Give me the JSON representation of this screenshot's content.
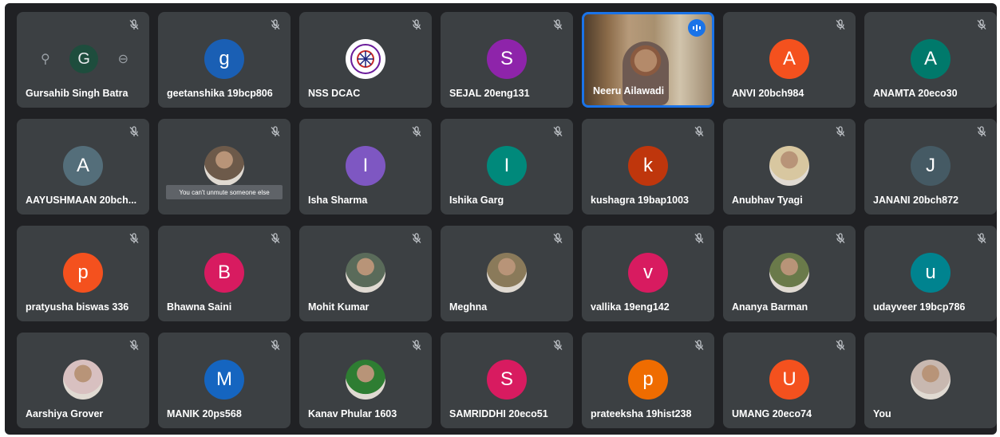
{
  "participants": [
    {
      "name": "Gursahib Singh Batra",
      "initial": "G",
      "color": "#1e4d3d",
      "muted": true,
      "avatar": "hover-controls"
    },
    {
      "name": "geetanshika 19bcp806",
      "initial": "g",
      "color": "#1a5fb4",
      "muted": true,
      "avatar": "letter"
    },
    {
      "name": "NSS DCAC",
      "initial": "",
      "color": "#ffffff",
      "muted": true,
      "avatar": "logo"
    },
    {
      "name": "SEJAL 20eng131",
      "initial": "S",
      "color": "#8e24aa",
      "muted": true,
      "avatar": "letter"
    },
    {
      "name": "Neeru Ailawadi",
      "initial": "",
      "color": "#1a73e8",
      "muted": false,
      "avatar": "video"
    },
    {
      "name": "ANVI 20bch984",
      "initial": "A",
      "color": "#f4511e",
      "muted": true,
      "avatar": "letter"
    },
    {
      "name": "ANAMTA 20eco30",
      "initial": "A",
      "color": "#00796b",
      "muted": true,
      "avatar": "letter"
    },
    {
      "name": "AAYUSHMAAN 20bch...",
      "initial": "A",
      "color": "#546e7a",
      "muted": true,
      "avatar": "letter"
    },
    {
      "name": "",
      "initial": "",
      "color": "#6d5a4a",
      "muted": true,
      "avatar": "photo",
      "tooltip": "You can't unmute someone else"
    },
    {
      "name": "Isha Sharma",
      "initial": "I",
      "color": "#7e57c2",
      "muted": true,
      "avatar": "letter"
    },
    {
      "name": "Ishika Garg",
      "initial": "I",
      "color": "#00897b",
      "muted": true,
      "avatar": "letter"
    },
    {
      "name": "kushagra 19bap1003",
      "initial": "k",
      "color": "#bf360c",
      "muted": true,
      "avatar": "letter"
    },
    {
      "name": "Anubhav Tyagi",
      "initial": "",
      "color": "#d8c7a0",
      "muted": true,
      "avatar": "photo"
    },
    {
      "name": "JANANI 20bch872",
      "initial": "J",
      "color": "#455a64",
      "muted": true,
      "avatar": "letter"
    },
    {
      "name": "pratyusha biswas 336",
      "initial": "p",
      "color": "#f4511e",
      "muted": true,
      "avatar": "letter"
    },
    {
      "name": "Bhawna Saini",
      "initial": "B",
      "color": "#d81b60",
      "muted": true,
      "avatar": "letter"
    },
    {
      "name": "Mohit Kumar",
      "initial": "",
      "color": "#5a6b5a",
      "muted": true,
      "avatar": "photo"
    },
    {
      "name": "Meghna",
      "initial": "",
      "color": "#8a7a5a",
      "muted": true,
      "avatar": "photo"
    },
    {
      "name": "vallika 19eng142",
      "initial": "v",
      "color": "#d81b60",
      "muted": true,
      "avatar": "letter"
    },
    {
      "name": "Ananya Barman",
      "initial": "",
      "color": "#6a7a4a",
      "muted": true,
      "avatar": "photo"
    },
    {
      "name": "udayveer 19bcp786",
      "initial": "u",
      "color": "#00838f",
      "muted": true,
      "avatar": "letter"
    },
    {
      "name": "Aarshiya Grover",
      "initial": "",
      "color": "#d8c0c0",
      "muted": true,
      "avatar": "photo"
    },
    {
      "name": "MANIK 20ps568",
      "initial": "M",
      "color": "#1565c0",
      "muted": true,
      "avatar": "letter"
    },
    {
      "name": "Kanav Phular 1603",
      "initial": "",
      "color": "#2e7d32",
      "muted": true,
      "avatar": "photo"
    },
    {
      "name": "SAMRIDDHI 20eco51",
      "initial": "S",
      "color": "#d81b60",
      "muted": true,
      "avatar": "letter"
    },
    {
      "name": "prateeksha 19hist238",
      "initial": "p",
      "color": "#ef6c00",
      "muted": true,
      "avatar": "letter"
    },
    {
      "name": "UMANG 20eco74",
      "initial": "U",
      "color": "#f4511e",
      "muted": true,
      "avatar": "letter"
    },
    {
      "name": "You",
      "initial": "",
      "color": "#c8b8b0",
      "muted": false,
      "avatar": "photo"
    }
  ]
}
